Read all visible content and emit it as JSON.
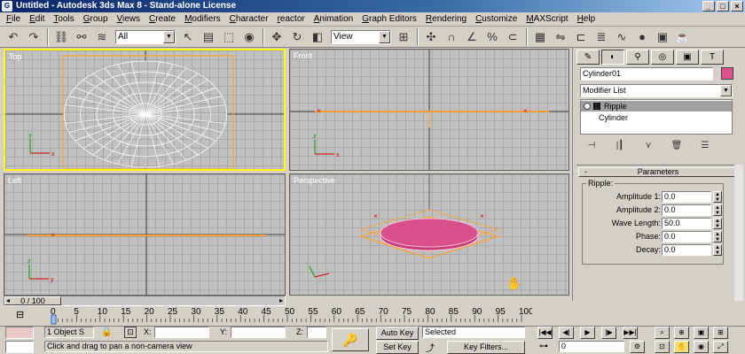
{
  "window": {
    "title": "Untitled - Autodesk 3ds Max 8  - Stand-alone License",
    "icon_glyph": "G"
  },
  "winbtns": [
    "_",
    "□",
    "×"
  ],
  "menu": [
    {
      "label": "File",
      "u": "F",
      "rest": "ile"
    },
    {
      "label": "Edit",
      "u": "E",
      "rest": "dit"
    },
    {
      "label": "Tools",
      "u": "T",
      "rest": "ools"
    },
    {
      "label": "Group",
      "u": "G",
      "rest": "roup"
    },
    {
      "label": "Views",
      "u": "V",
      "rest": "iews"
    },
    {
      "label": "Create",
      "u": "C",
      "rest": "reate"
    },
    {
      "label": "Modifiers",
      "u": "M",
      "rest": "odifiers"
    },
    {
      "label": "Character",
      "u": "C",
      "rest": "haracter"
    },
    {
      "label": "reactor",
      "u": "r",
      "rest": "eactor"
    },
    {
      "label": "Animation",
      "u": "A",
      "rest": "nimation"
    },
    {
      "label": "Graph Editors",
      "u": "G",
      "rest": "raph Editors"
    },
    {
      "label": "Rendering",
      "u": "R",
      "rest": "endering"
    },
    {
      "label": "Customize",
      "u": "C",
      "rest": "ustomize"
    },
    {
      "label": "MAXScript",
      "u": "M",
      "rest": "AXScript"
    },
    {
      "label": "Help",
      "u": "H",
      "rest": "elp"
    }
  ],
  "toolbar": {
    "selection_filter": "All",
    "ref_coord": "View",
    "icons": [
      "undo-icon",
      "redo-icon",
      "link-icon",
      "unlink-icon",
      "bind-spacewarp-icon",
      "select-icon",
      "select-by-name-icon",
      "rect-region-icon",
      "window-crossing-icon",
      "move-icon",
      "rotate-icon",
      "scale-icon",
      "pivot-icon",
      "mirror-icon",
      "align-icon",
      "snap-3d-icon",
      "angle-snap-icon",
      "percent-snap-icon",
      "spinner-snap-icon",
      "named-sel-icon",
      "material-editor-icon",
      "render-scene-icon",
      "quick-render-icon"
    ]
  },
  "viewports": {
    "top": {
      "label": "Top",
      "active": true
    },
    "front": {
      "label": "Front"
    },
    "left": {
      "label": "Left"
    },
    "perspective": {
      "label": "Perspective"
    }
  },
  "command_panel": {
    "tabs": [
      "create-tab",
      "modify-tab",
      "hierarchy-tab",
      "motion-tab",
      "display-tab",
      "utilities-tab"
    ],
    "object_name": "Cylinder01",
    "object_color": "#e0508c",
    "modifier_list": "Modifier List",
    "stack": {
      "selected": "Ripple",
      "base": "Cylinder"
    },
    "rollout_title": "Parameters",
    "rollout_minus": "-",
    "group_label": "Ripple:",
    "params": [
      {
        "label": "Amplitude 1:",
        "value": "0.0"
      },
      {
        "label": "Amplitude 2:",
        "value": "0.0"
      },
      {
        "label": "Wave Length:",
        "value": "50.0"
      },
      {
        "label": "Phase:",
        "value": "0.0"
      },
      {
        "label": "Decay:",
        "value": "0.0"
      }
    ]
  },
  "timeline": {
    "slider_label": "0 / 100",
    "current": 0,
    "max": 100,
    "tick_labels": [
      "0",
      "5",
      "10",
      "15",
      "20",
      "25",
      "30",
      "35",
      "40",
      "45",
      "50",
      "55",
      "60",
      "65",
      "70",
      "75",
      "80",
      "85",
      "90",
      "95",
      "100"
    ]
  },
  "status": {
    "selection_count": "1 Object S",
    "x_label": "X:",
    "y_label": "Y:",
    "z_label": "Z:",
    "x_value": "",
    "y_value": "",
    "z_value": "",
    "prompt": "Click and drag to pan a non-camera view",
    "auto_key": "Auto Key",
    "set_key": "Set Key",
    "key_mode": "Selected",
    "key_filters": "Key Filters...",
    "frame": "0"
  },
  "colors": {
    "active_viewport": "#ffff00",
    "object": "#e0508c",
    "bounding": "#ffa030"
  }
}
